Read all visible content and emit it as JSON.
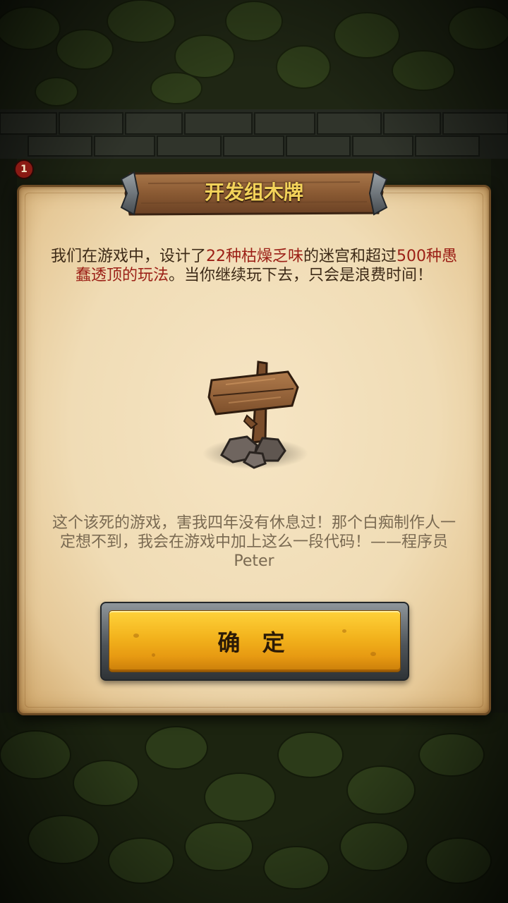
{
  "dialog": {
    "title": "开发组木牌",
    "intro_segments": [
      {
        "text": "我们在游戏中，设计了",
        "highlight": false
      },
      {
        "text": "22种枯燥乏味",
        "highlight": true
      },
      {
        "text": "的迷宫和超过",
        "highlight": false
      },
      {
        "text": "500种愚蠢透顶的玩法",
        "highlight": true
      },
      {
        "text": "。当你继续玩下去，只会是浪费时间！",
        "highlight": false
      }
    ],
    "quote": "这个该死的游戏，害我四年没有休息过！那个白痴制作人一定想不到，我会在游戏中加上这么一段代码！——程序员 Peter",
    "confirm_label": "确 定",
    "illustration_icon": "wooden-signpost-icon"
  },
  "colors": {
    "highlight": "#9b1f16",
    "title": "#f3d35a",
    "body_text": "#3d2a17",
    "quote_text": "#7a6a52",
    "button": "#f2b21c"
  },
  "hud": {
    "badge_count": "1"
  }
}
